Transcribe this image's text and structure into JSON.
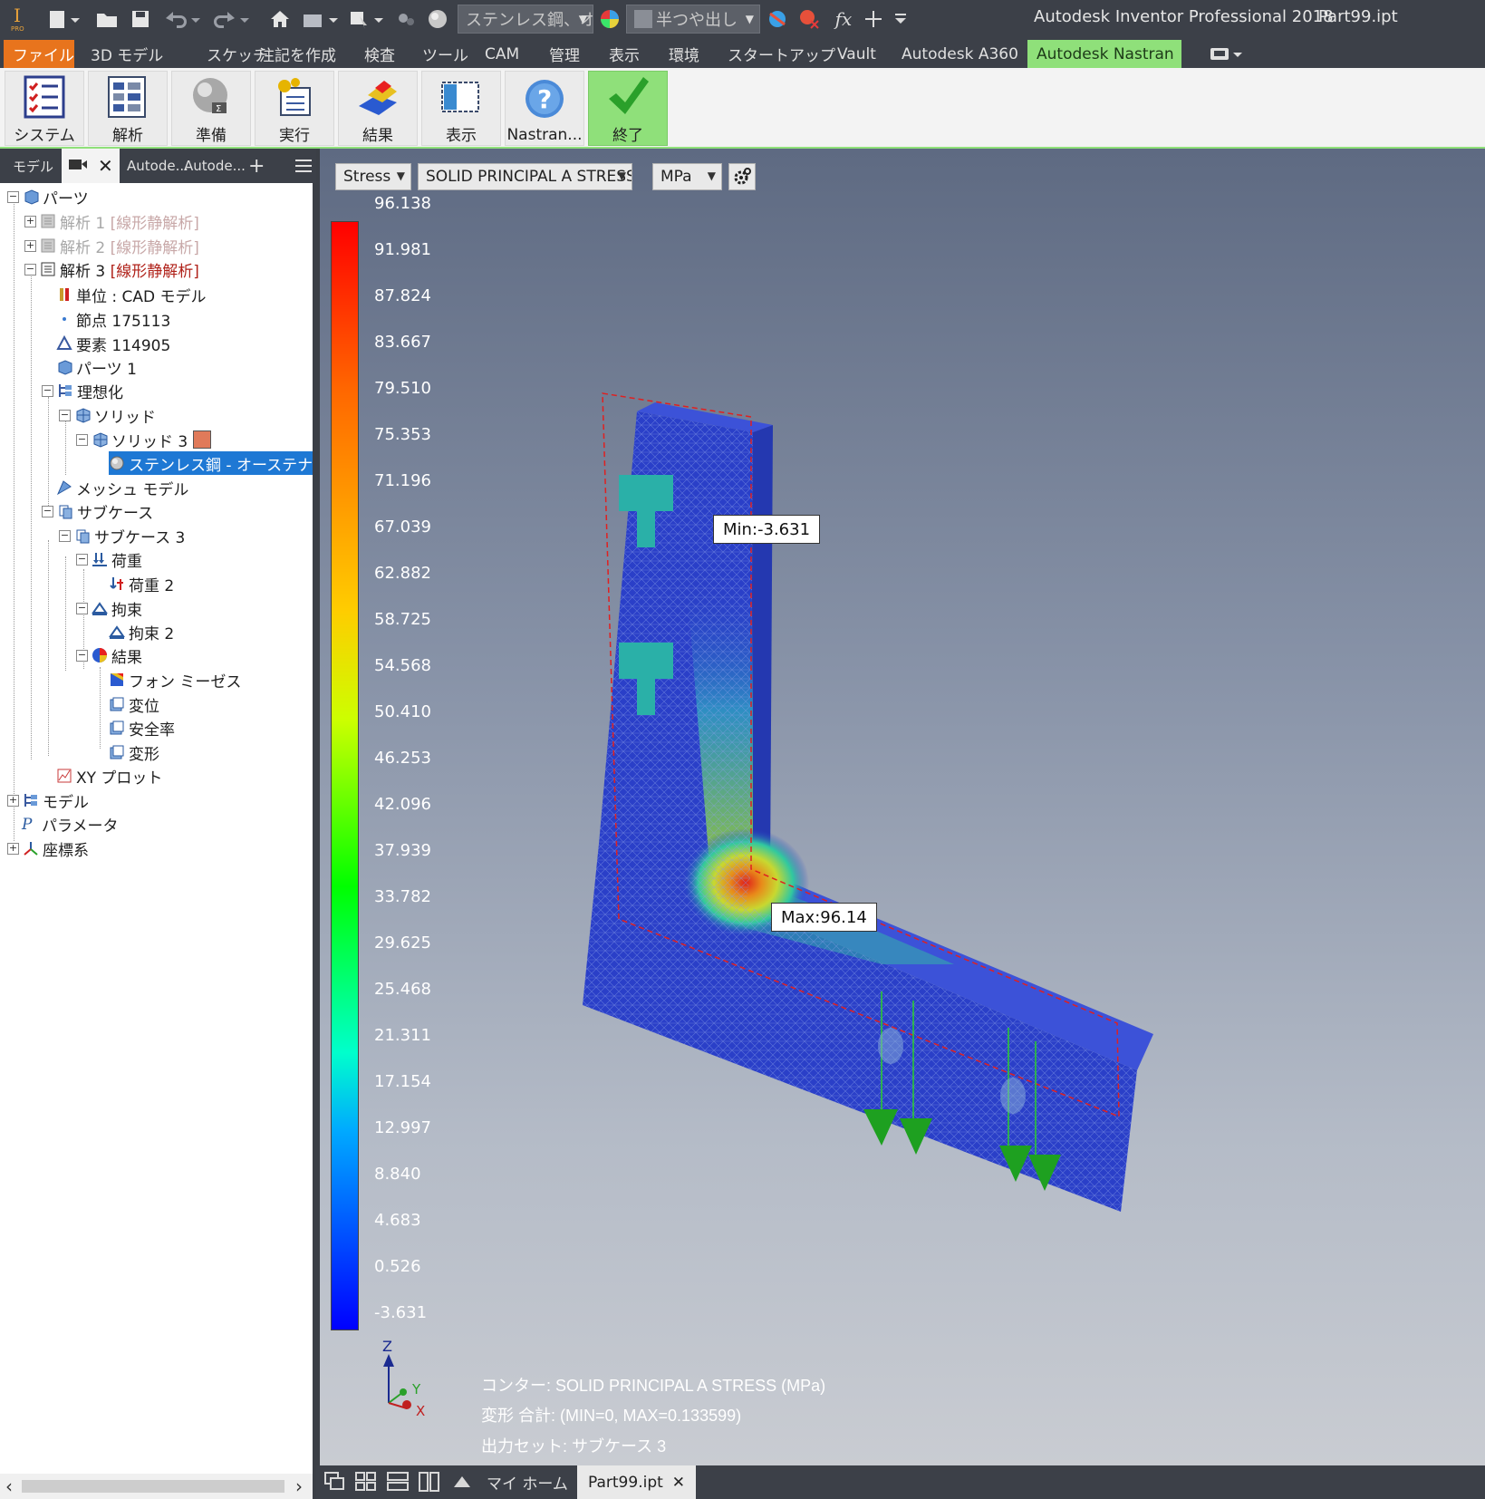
{
  "titlebar": {
    "app_title": "Autodesk Inventor Professional 2018",
    "file_title": "Part99.ipt",
    "material_combo": "ステンレス鋼、オ",
    "appearance_combo": "半つや出し",
    "fx_label": "fx"
  },
  "menu": {
    "tabs": [
      "ファイル",
      "3D モデル",
      "スケッチ",
      "注記を作成",
      "検査",
      "ツール",
      "CAM",
      "管理",
      "表示",
      "環境",
      "スタートアップ",
      "Vault",
      "Autodesk A360",
      "Autodesk Nastran"
    ],
    "active": "Autodesk Nastran"
  },
  "ribbon": {
    "buttons": [
      "システム",
      "解析",
      "準備",
      "実行",
      "結果",
      "表示",
      "Nastran...",
      "終了"
    ]
  },
  "browser": {
    "tabs": [
      "モデル",
      "Autode...",
      "Autode..."
    ],
    "add_label": "+",
    "tree": {
      "parts": "パーツ",
      "analysis1": "解析 1",
      "analysis1_tag": "[線形静解析]",
      "analysis2": "解析 2",
      "analysis2_tag": "[線形静解析]",
      "analysis3": "解析 3",
      "analysis3_tag": "[線形静解析]",
      "units": "単位 : CAD モデル",
      "nodes": "節点 175113",
      "elements": "要素 114905",
      "parts1": "パーツ 1",
      "idealization": "理想化",
      "solid": "ソリッド",
      "solid3": "ソリッド 3",
      "material": "ステンレス鋼 - オーステナイト系",
      "mesh_model": "メッシュ モデル",
      "subcase": "サブケース",
      "subcase3": "サブケース 3",
      "load": "荷重",
      "load2": "荷重 2",
      "constraint": "拘束",
      "constraint2": "拘束 2",
      "results": "結果",
      "von_mises": "フォン ミーゼス",
      "displacement": "変位",
      "safety_factor": "安全率",
      "deformation": "変形",
      "xy_plot": "XY プロット",
      "model": "モデル",
      "parameters": "パラメータ",
      "coordinate_system": "座標系"
    }
  },
  "viewport": {
    "result_type": "Stress",
    "component": "SOLID PRINCIPAL A STRESS",
    "unit": "MPa",
    "legend": [
      "96.138",
      "91.981",
      "87.824",
      "83.667",
      "79.510",
      "75.353",
      "71.196",
      "67.039",
      "62.882",
      "58.725",
      "54.568",
      "50.410",
      "46.253",
      "42.096",
      "37.939",
      "33.782",
      "29.625",
      "25.468",
      "21.311",
      "17.154",
      "12.997",
      "8.840",
      "4.683",
      "0.526",
      "-3.631"
    ],
    "min_label": "Min:-3.631",
    "max_label": "Max:96.14",
    "info": {
      "contour": "コンター: SOLID PRINCIPAL A STRESS (MPa)",
      "deform": "変形 合計: (MIN=0, MAX=0.133599)",
      "output_set": "出力セット: サブケース 3"
    },
    "triad": {
      "z": "Z",
      "y": "Y",
      "x": "X"
    }
  },
  "doctabs": {
    "home": "マイ ホーム",
    "file": "Part99.ipt",
    "close": "✕"
  },
  "colors": {
    "file_tab": "#e8741d",
    "active_tab": "#8fe07a",
    "selection": "#1e78d4",
    "mesh_blue": "#2a3fc8",
    "stress_red": "#e0201a"
  }
}
